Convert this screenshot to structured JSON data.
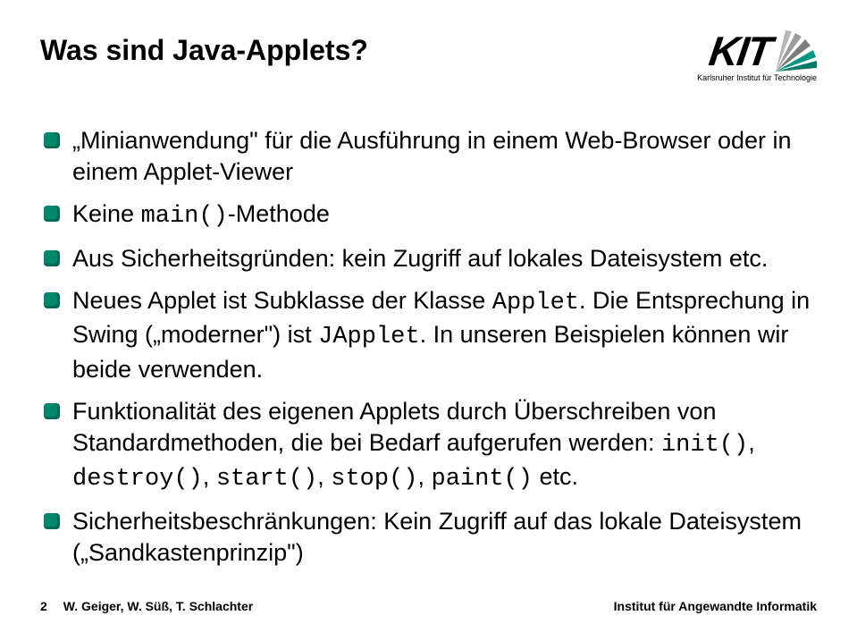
{
  "header": {
    "title": "Was sind Java-Applets?",
    "logo_text": "KIT",
    "logo_tagline": "Karlsruher Institut für Technologie"
  },
  "bullets": [
    {
      "parts": [
        {
          "t": "„Minianwendung\" für die Ausführung in einem Web-Browser oder in einem Applet-Viewer"
        }
      ]
    },
    {
      "parts": [
        {
          "t": "Keine "
        },
        {
          "t": "main()",
          "mono": true
        },
        {
          "t": "-Methode"
        }
      ]
    },
    {
      "parts": [
        {
          "t": "Aus Sicherheitsgründen: kein Zugriff auf lokales Dateisystem etc."
        }
      ]
    },
    {
      "parts": [
        {
          "t": "Neues Applet ist Subklasse der Klasse "
        },
        {
          "t": "Applet",
          "mono": true
        },
        {
          "t": ". Die Entsprechung in Swing („moderner\") ist "
        },
        {
          "t": "JApplet",
          "mono": true
        },
        {
          "t": ". In unseren Beispielen können wir beide verwenden."
        }
      ]
    },
    {
      "parts": [
        {
          "t": "Funktionalität des eigenen Applets durch Überschreiben von Standardmethoden, die bei Bedarf aufgerufen werden: "
        },
        {
          "t": "init()",
          "mono": true
        },
        {
          "t": ", "
        },
        {
          "t": "destroy()",
          "mono": true
        },
        {
          "t": ", "
        },
        {
          "t": "start()",
          "mono": true
        },
        {
          "t": ", "
        },
        {
          "t": "stop()",
          "mono": true
        },
        {
          "t": ", "
        },
        {
          "t": "paint()",
          "mono": true
        },
        {
          "t": " etc."
        }
      ]
    },
    {
      "parts": [
        {
          "t": "Sicherheitsbeschränkungen: Kein Zugriff auf das lokale Dateisystem („Sandkastenprinzip\")"
        }
      ]
    }
  ],
  "footer": {
    "page": "2",
    "authors": "W. Geiger, W. Süß, T. Schlachter",
    "institute": "Institut für Angewandte Informatik"
  },
  "colors": {
    "accent": "#00876C",
    "accent_dark": "#006B55"
  }
}
